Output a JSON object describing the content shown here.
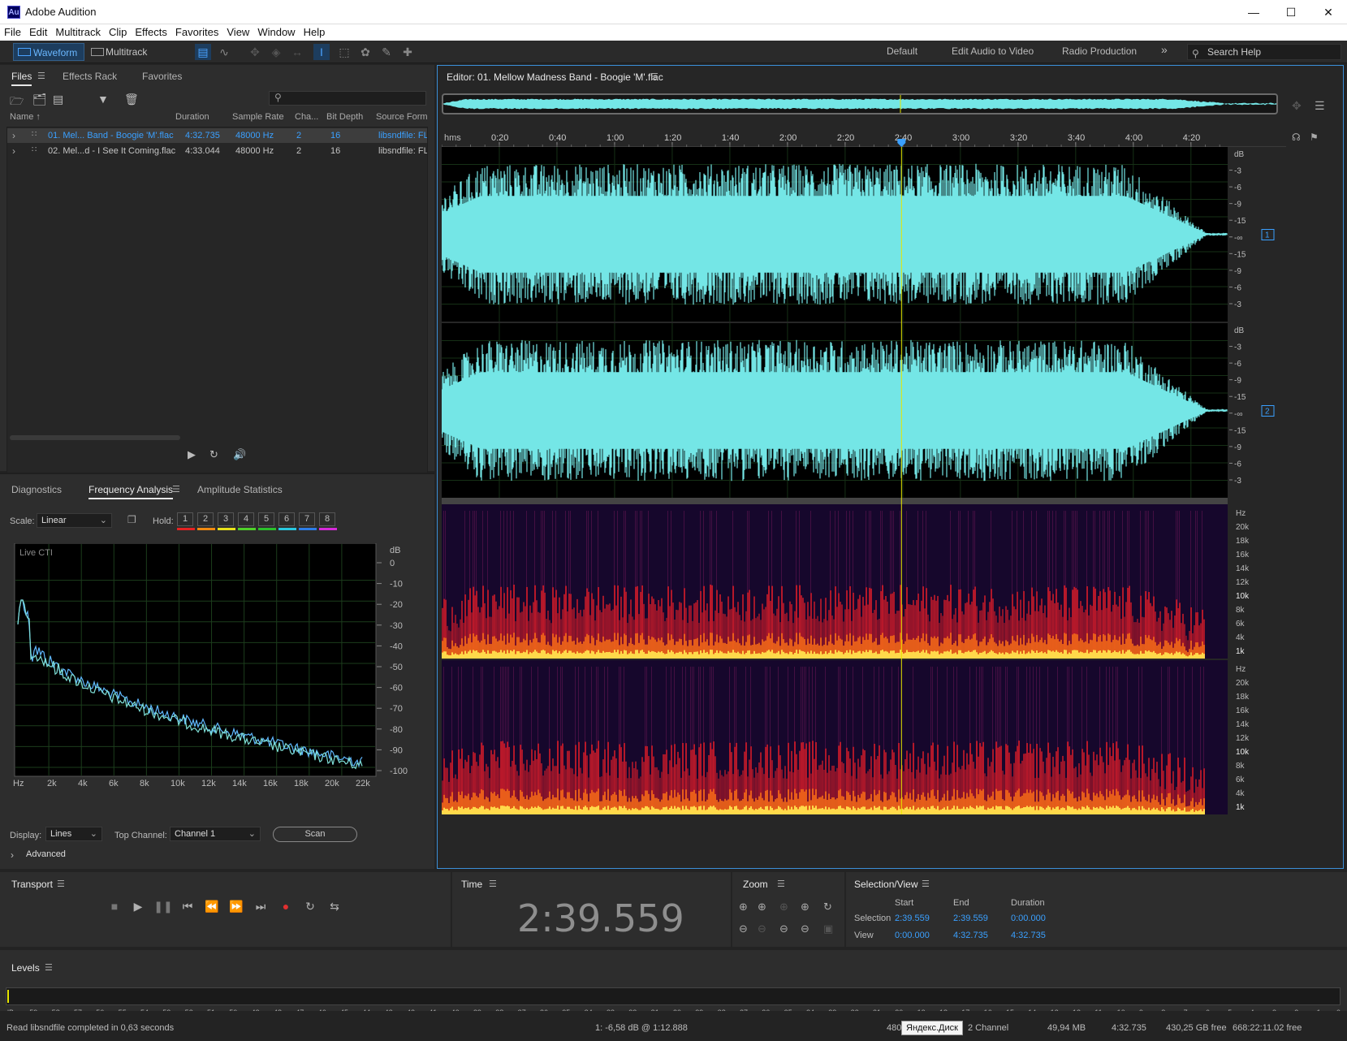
{
  "window": {
    "app_icon": "Au",
    "title": "Adobe Audition",
    "controls": [
      "minimize",
      "maximize",
      "close"
    ]
  },
  "menu": [
    "File",
    "Edit",
    "Multitrack",
    "Clip",
    "Effects",
    "Favorites",
    "View",
    "Window",
    "Help"
  ],
  "toolbar": {
    "modes": [
      "Waveform",
      "Multitrack"
    ],
    "workspaces": [
      "Default",
      "Edit Audio to Video",
      "Radio Production"
    ],
    "more": "»",
    "search_placeholder": "Search Help"
  },
  "files_panel": {
    "tabs": [
      "Files",
      "Effects Rack",
      "Favorites"
    ],
    "columns": [
      "Name",
      "Duration",
      "Sample Rate",
      "Cha...",
      "Bit Depth",
      "Source Format"
    ],
    "rows": [
      {
        "name": "01. Mel... Band - Boogie 'M'.flac",
        "duration": "4:32.735",
        "sample_rate": "48000 Hz",
        "channels": "2",
        "bit_depth": "16",
        "source": "libsndfile: FLAC",
        "selected": true
      },
      {
        "name": "02. Mel...d - I See It Coming.flac",
        "duration": "4:33.044",
        "sample_rate": "48000 Hz",
        "channels": "2",
        "bit_depth": "16",
        "source": "libsndfile: FLAC",
        "selected": false
      }
    ]
  },
  "analysis_panel": {
    "tabs": [
      "Diagnostics",
      "Frequency Analysis",
      "Amplitude Statistics"
    ],
    "scale_label": "Scale:",
    "scale_value": "Linear",
    "hold_label": "Hold:",
    "hold_buttons": [
      "1",
      "2",
      "3",
      "4",
      "5",
      "6",
      "7",
      "8"
    ],
    "hold_colors": [
      "#e52222",
      "#f08a10",
      "#e8e21a",
      "#4fd12a",
      "#2bc12b",
      "#29c9e0",
      "#2d7de8",
      "#d62ad9"
    ],
    "graph_label": "Live CTI",
    "db_ticks": [
      "dB",
      "0",
      "-10",
      "-20",
      "-30",
      "-40",
      "-50",
      "-60",
      "-70",
      "-80",
      "-90",
      "-100"
    ],
    "hz_ticks": [
      "Hz",
      "2k",
      "4k",
      "6k",
      "8k",
      "10k",
      "12k",
      "14k",
      "16k",
      "18k",
      "20k",
      "22k"
    ],
    "display_label": "Display:",
    "display_value": "Lines",
    "top_channel_label": "Top Channel:",
    "top_channel_value": "Channel 1",
    "scan_button": "Scan",
    "advanced": "Advanced"
  },
  "editor": {
    "title": "Editor: 01. Mellow Madness Band - Boogie 'M'.flac",
    "ruler_label": "hms",
    "ruler_ticks": [
      "0:20",
      "0:40",
      "1:00",
      "1:20",
      "1:40",
      "2:00",
      "2:20",
      "2:40",
      "3:00",
      "3:20",
      "3:40",
      "4:00",
      "4:20"
    ],
    "db_scale": [
      "dB",
      "-3",
      "-6",
      "-9",
      "-15",
      "-∞",
      "-15",
      "-9",
      "-6",
      "-3"
    ],
    "channel_badges": [
      "1",
      "2"
    ],
    "hz_scale": [
      "Hz",
      "20k",
      "18k",
      "16k",
      "14k",
      "12k",
      "10k",
      "8k",
      "6k",
      "4k",
      "1k"
    ],
    "playhead_time": "2:39.559",
    "duration": "4:32.735"
  },
  "transport": {
    "title": "Transport",
    "buttons": [
      "stop",
      "play",
      "pause",
      "to-start",
      "rewind",
      "fast-forward",
      "to-end",
      "record",
      "loop",
      "skip-selection"
    ]
  },
  "time_panel": {
    "title": "Time",
    "value": "2:39.559"
  },
  "zoom_panel": {
    "title": "Zoom"
  },
  "selection_panel": {
    "title": "Selection/View",
    "headers": [
      "Start",
      "End",
      "Duration"
    ],
    "rows": [
      {
        "label": "Selection",
        "start": "2:39.559",
        "end": "2:39.559",
        "duration": "0:00.000"
      },
      {
        "label": "View",
        "start": "0:00.000",
        "end": "4:32.735",
        "duration": "4:32.735"
      }
    ]
  },
  "levels": {
    "title": "Levels",
    "scale": [
      "dB",
      "-59",
      "-58",
      "-57",
      "-56",
      "-55",
      "-54",
      "-53",
      "-52",
      "-51",
      "-50",
      "-49",
      "-48",
      "-47",
      "-46",
      "-45",
      "-44",
      "-43",
      "-42",
      "-41",
      "-40",
      "-39",
      "-38",
      "-37",
      "-36",
      "-35",
      "-34",
      "-33",
      "-32",
      "-31",
      "-30",
      "-29",
      "-28",
      "-27",
      "-26",
      "-25",
      "-24",
      "-23",
      "-22",
      "-21",
      "-20",
      "-19",
      "-18",
      "-17",
      "-16",
      "-15",
      "-14",
      "-13",
      "-12",
      "-11",
      "-10",
      "-9",
      "-8",
      "-7",
      "-6",
      "-5",
      "-4",
      "-3",
      "-2",
      "-1",
      "0"
    ]
  },
  "statusbar": {
    "message": "Read libsndfile completed in 0,63 seconds",
    "cursor": "1: -6,58 dB @ 1:12.888",
    "sample_rate": "480",
    "overlay": "Яндекс.Диск",
    "channels": "2 Channel",
    "size": "49,94 MB",
    "duration": "4:32.735",
    "free": "430,25 GB free",
    "free_time": "668:22:11.02 free"
  },
  "colors": {
    "waveform": "#74e6e6",
    "playhead": "#e6e600",
    "accent": "#3aa0ff",
    "record": "#e03030"
  }
}
